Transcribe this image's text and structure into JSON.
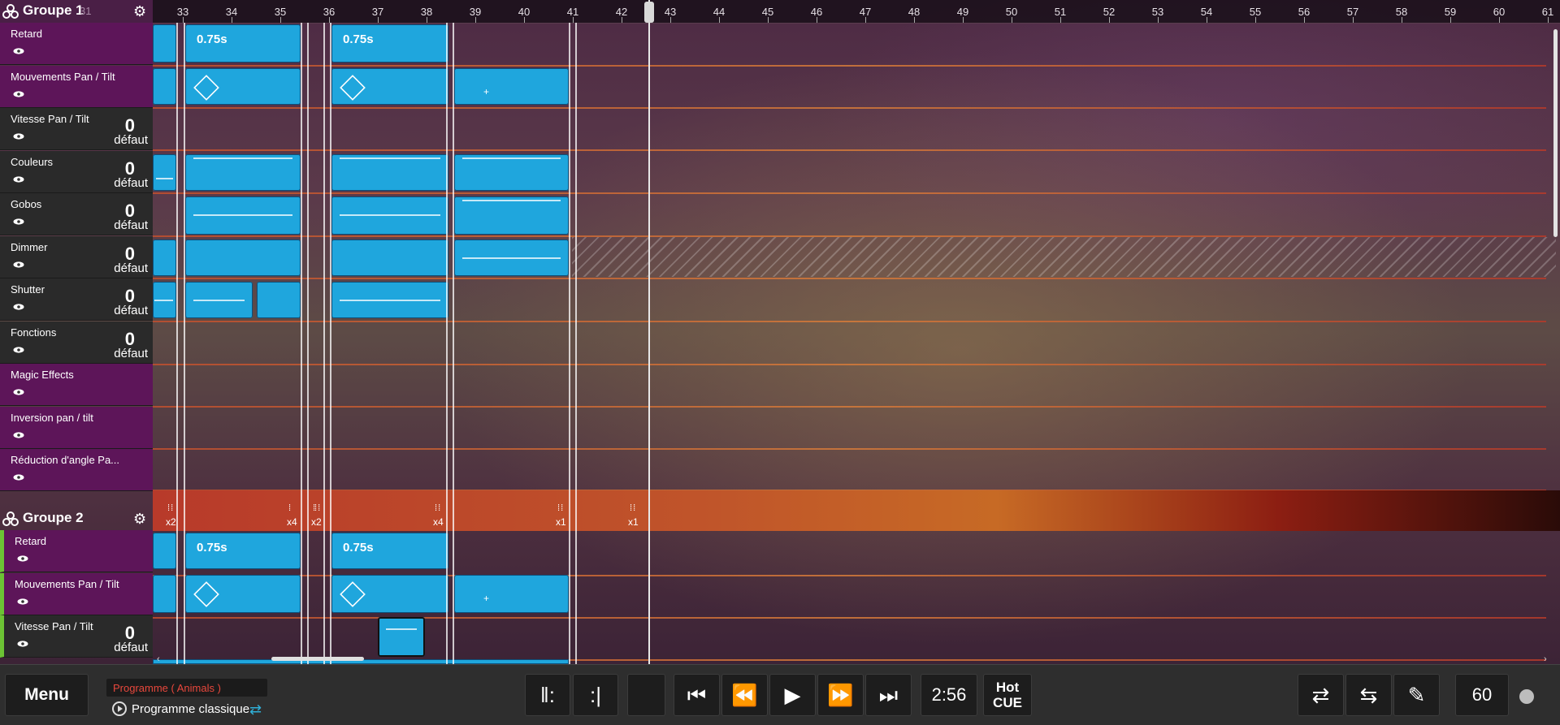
{
  "ruler": {
    "ticks": [
      "33",
      "34",
      "35",
      "36",
      "37",
      "38",
      "39",
      "40",
      "41",
      "42",
      "43",
      "44",
      "45",
      "46",
      "47",
      "48",
      "49",
      "50",
      "51",
      "52",
      "53",
      "54",
      "55",
      "56",
      "57",
      "58",
      "59",
      "60",
      "61"
    ]
  },
  "groups": [
    {
      "name": "Groupe 1",
      "number": "31",
      "tracks": [
        {
          "name": "Retard",
          "value": "",
          "default_label": ""
        },
        {
          "name": "Mouvements Pan / Tilt",
          "value": "",
          "default_label": ""
        },
        {
          "name": "Vitesse Pan / Tilt",
          "value": "0",
          "default_label": "défaut"
        },
        {
          "name": "Couleurs",
          "value": "0",
          "default_label": "défaut"
        },
        {
          "name": "Gobos",
          "value": "0",
          "default_label": "défaut"
        },
        {
          "name": "Dimmer",
          "value": "0",
          "default_label": "défaut"
        },
        {
          "name": "Shutter",
          "value": "0",
          "default_label": "défaut"
        },
        {
          "name": "Fonctions",
          "value": "0",
          "default_label": "défaut"
        },
        {
          "name": "Magic Effects",
          "value": "",
          "default_label": ""
        },
        {
          "name": "Inversion pan / tilt",
          "value": "",
          "default_label": ""
        },
        {
          "name": "Réduction d'angle Pa...",
          "value": "",
          "default_label": ""
        }
      ]
    },
    {
      "name": "Groupe 2",
      "number": "",
      "tracks": [
        {
          "name": "Retard",
          "value": "",
          "default_label": ""
        },
        {
          "name": "Mouvements Pan / Tilt",
          "value": "",
          "default_label": ""
        },
        {
          "name": "Vitesse Pan / Tilt",
          "value": "0",
          "default_label": "défaut"
        }
      ]
    }
  ],
  "blocks": {
    "delay_label": "0.75s"
  },
  "repeats": [
    "x2",
    "x4",
    "x2",
    "x4",
    "x1",
    "x1"
  ],
  "toolbar": {
    "menu_label": "Menu",
    "program_name": "Programme ( Animals )",
    "program_mode": "Programme classique",
    "time": "2:56",
    "hotcue_line1": "Hot",
    "hotcue_line2": "CUE",
    "bpm": "60"
  },
  "icons": [
    "gear-icon",
    "eye-icon",
    "group-icon",
    "loop-icon",
    "skip-start-icon",
    "rewind-icon",
    "play-icon",
    "fast-forward-icon",
    "skip-end-icon",
    "loop-in-icon",
    "loop-out-icon",
    "swap-icon",
    "merge-icon",
    "brush-icon",
    "record-indicator"
  ],
  "colors": {
    "block": "#1fa6dd",
    "track_purple": "#5d1559",
    "track_dark": "#2a2a2a",
    "group2_accent": "#6cc334",
    "program_name": "#e8473c"
  }
}
